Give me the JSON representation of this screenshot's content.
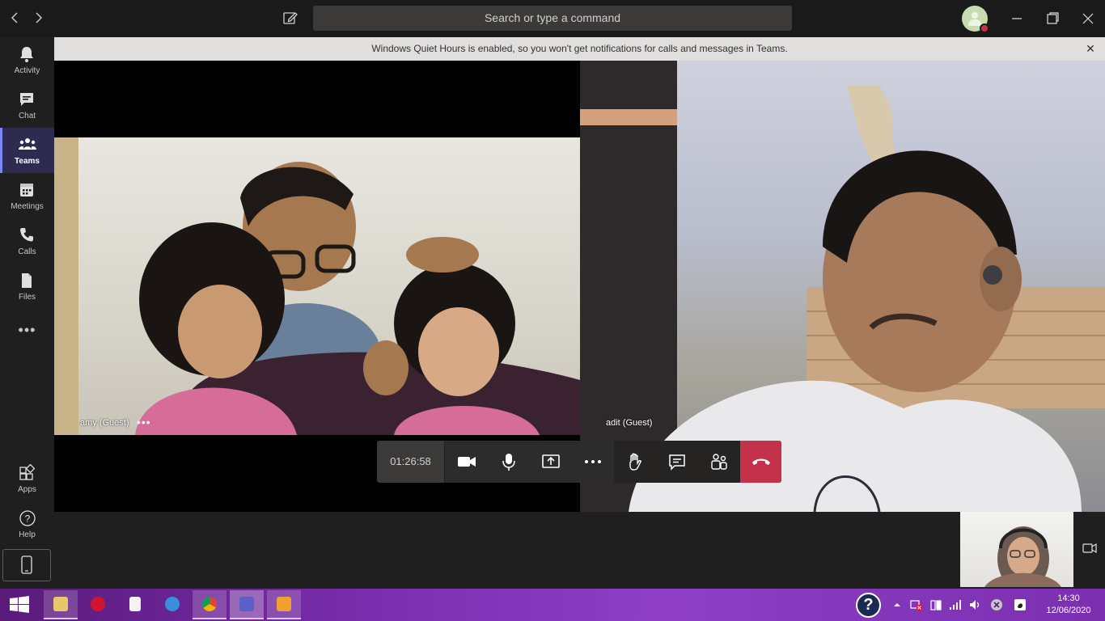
{
  "titlebar": {
    "search_placeholder": "Search or type a command",
    "back_icon": "chevron-left-icon",
    "forward_icon": "chevron-right-icon",
    "compose_icon": "compose-icon",
    "minimize_icon": "minimize-icon",
    "restore_icon": "restore-icon",
    "close_icon": "close-icon"
  },
  "rail": {
    "items": [
      {
        "label": "Activity",
        "icon": "bell-icon"
      },
      {
        "label": "Chat",
        "icon": "chat-icon"
      },
      {
        "label": "Teams",
        "icon": "teams-icon",
        "active": true
      },
      {
        "label": "Meetings",
        "icon": "calendar-icon"
      },
      {
        "label": "Calls",
        "icon": "phone-icon"
      },
      {
        "label": "Files",
        "icon": "file-icon"
      }
    ],
    "more": "•••",
    "bottom_items": [
      {
        "label": "Apps",
        "icon": "apps-icon"
      },
      {
        "label": "Help",
        "icon": "help-icon"
      }
    ]
  },
  "banner": {
    "text": "Windows Quiet Hours is enabled, so you won't get notifications for calls and messages in Teams.",
    "close": "✕"
  },
  "participants": [
    {
      "name": "amy (Guest)",
      "more": "•••"
    },
    {
      "name": "adit (Guest)"
    }
  ],
  "controls": {
    "timer": "01:26:58",
    "buttons": [
      "camera-icon",
      "microphone-icon",
      "share-screen-icon",
      "more-options-icon",
      "raise-hand-icon",
      "chat-icon",
      "participants-icon",
      "hang-up-icon"
    ]
  },
  "taskbar": {
    "time": "14:30",
    "date": "12/06/2020",
    "help": "?",
    "apps": [
      "file-explorer-icon",
      "opera-icon",
      "notepad-icon",
      "ie-icon",
      "chrome-icon",
      "teams-icon",
      "media-player-icon"
    ]
  },
  "colors": {
    "accent": "#7f85f5",
    "hangup": "#c4314b",
    "status_busy": "#c4314b",
    "taskbar": "#7b2fb0"
  }
}
